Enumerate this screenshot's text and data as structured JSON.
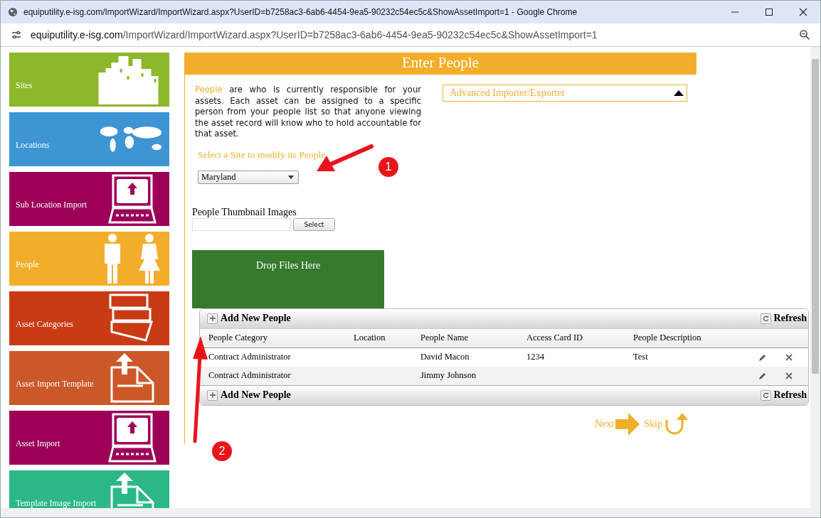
{
  "window": {
    "title": "equiputility.e-isg.com/ImportWizard/ImportWizard.aspx?UserID=b7258ac3-6ab6-4454-9ea5-90232c54ec5c&ShowAssetImport=1 - Google Chrome"
  },
  "address_bar": {
    "domain": "equiputility.e-isg.com",
    "path": "/ImportWizard/ImportWizard.aspx?UserID=b7258ac3-6ab6-4454-9ea5-90232c54ec5c&ShowAssetImport=1"
  },
  "sidebar": {
    "items": [
      {
        "label": "Sites",
        "kind": "city",
        "color": "#8db82b"
      },
      {
        "label": "Locations",
        "kind": "map",
        "color": "#3d95d4"
      },
      {
        "label": "Sub Location Import",
        "kind": "computer",
        "color": "#9c0057"
      },
      {
        "label": "People",
        "kind": "people",
        "color": "#f2ae2b"
      },
      {
        "label": "Asset Categories",
        "kind": "books",
        "color": "#c93b14"
      },
      {
        "label": "Asset Import Template",
        "kind": "document",
        "color": "#cc582a"
      },
      {
        "label": "Asset Import",
        "kind": "computer",
        "color": "#9c0057"
      },
      {
        "label": "Template Image Import",
        "kind": "document",
        "color": "#2bb884"
      }
    ]
  },
  "main": {
    "title": "Enter People",
    "intro": {
      "highlight": "People",
      "text": " are who is currently responsible for your assets. Each asset can be assigned to a specific person from your people list so that anyone viewing the asset record will know who to hold accountable for that asset."
    },
    "advanced_panel": {
      "label": "Advanced Importer/Exporter",
      "expanded": false
    },
    "site_select": {
      "label": "Select a Site to modify its People",
      "value": "Maryland"
    },
    "thumbnails": {
      "label": "People Thumbnail Images",
      "button": "Select"
    },
    "drop_zone": "Drop Files Here",
    "grid": {
      "add_label": "Add New People",
      "refresh_label": "Refresh",
      "columns": [
        "People Category",
        "Location",
        "People Name",
        "Access Card ID",
        "People Description"
      ],
      "rows": [
        {
          "cells": [
            "Contract Administrator",
            "",
            "David Macon",
            "1234",
            "Test"
          ]
        },
        {
          "cells": [
            "Contract Administrator",
            "",
            "Jimmy Johnson",
            "",
            ""
          ]
        }
      ],
      "footer_add_label": "Add New People",
      "footer_refresh_label": "Refresh"
    },
    "next": "Next",
    "skip": "Skip"
  },
  "annotations": [
    "1",
    "2"
  ]
}
